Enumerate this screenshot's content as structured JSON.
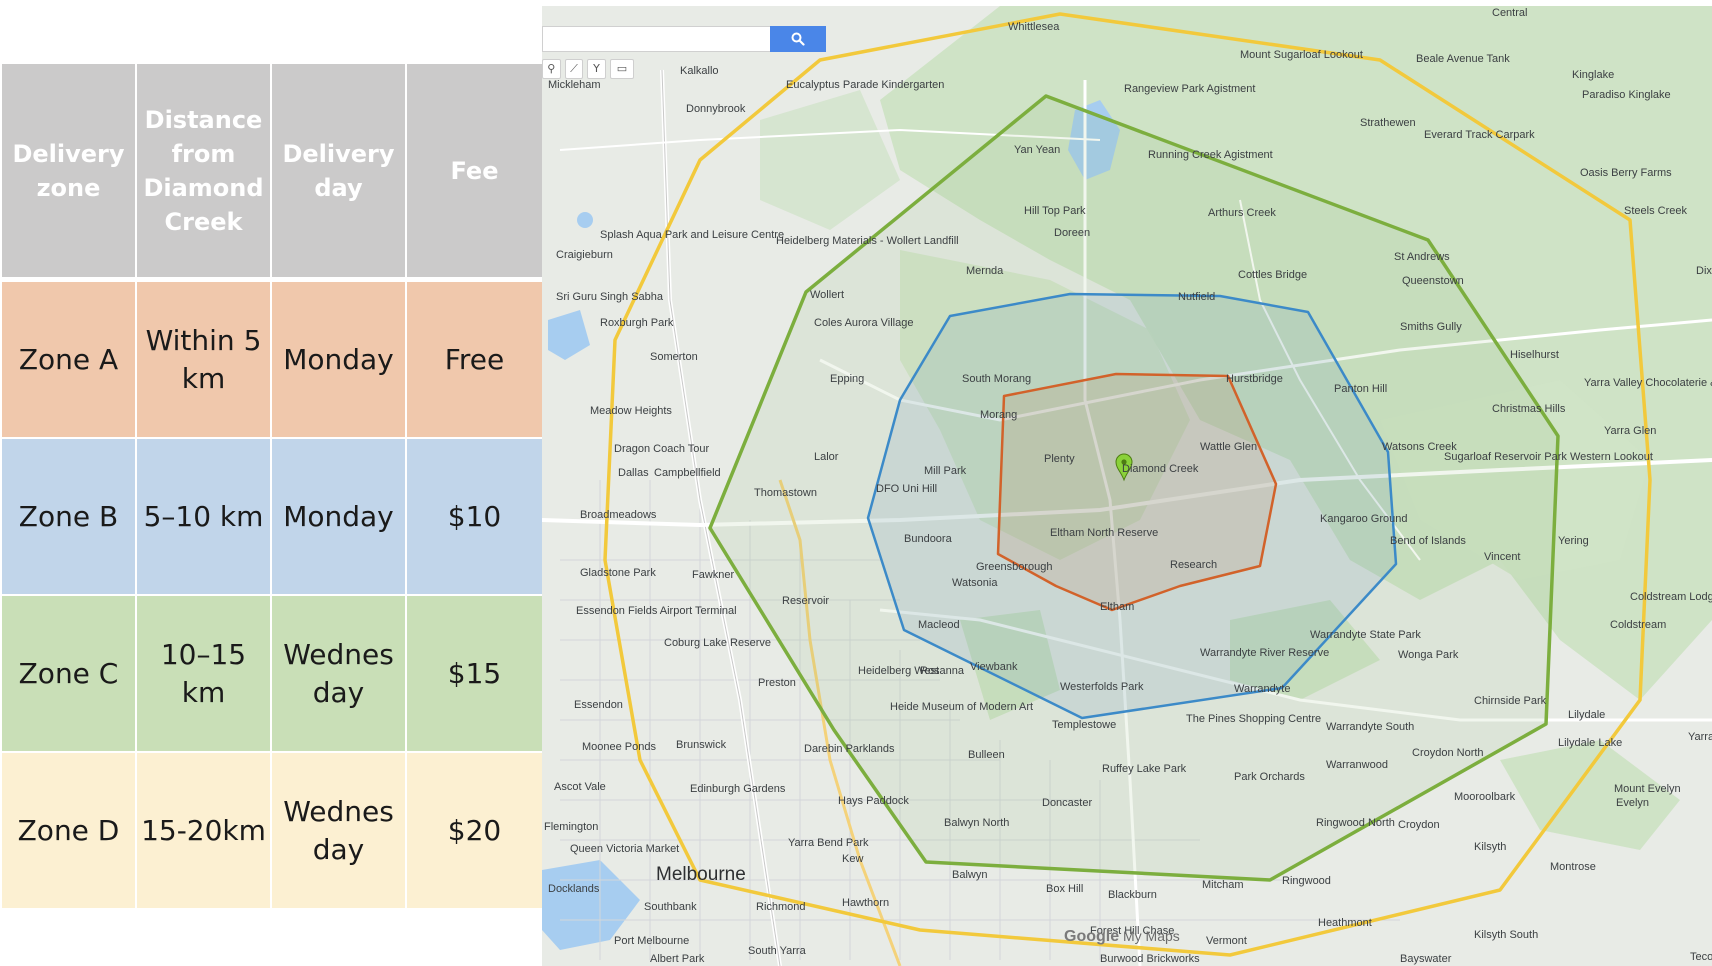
{
  "table": {
    "headers": [
      "Delivery zone",
      "Distance from Diamond Creek",
      "Delivery day",
      "Fee"
    ],
    "rows": [
      {
        "zone": "Zone A",
        "distance": "Within 5 km",
        "day": "Monday",
        "fee": "Free"
      },
      {
        "zone": "Zone B",
        "distance": "5–10 km",
        "day": "Monday",
        "fee": "$10"
      },
      {
        "zone": "Zone C",
        "distance": "10–15 km",
        "day": "Wednes day",
        "fee": "$15"
      },
      {
        "zone": "Zone D",
        "distance": "15-20km",
        "day": "Wednes day",
        "fee": "$20"
      }
    ],
    "colors": {
      "header": "#cbcaca",
      "zone_a": "#f0c8ac",
      "zone_b": "#c1d5ea",
      "zone_c": "#c9dfb7",
      "zone_d": "#fcf0d2"
    }
  },
  "map": {
    "watermark_logo": "Google",
    "watermark_text": "My Maps",
    "search_icon": "search-icon",
    "tools": [
      "marker-icon",
      "draw-line-icon",
      "directions-icon",
      "ruler-icon"
    ],
    "zone_colors": {
      "zone_a": "#d2622a",
      "zone_b": "#3c8ac8",
      "zone_c": "#7cae3e",
      "zone_d": "#f2c93c"
    },
    "center_marker": "Diamond Creek",
    "places": [
      "Whittlesea",
      "Kalkallo",
      "Mickleham",
      "Donnybrook",
      "Eucalyptus Parade Kindergarten",
      "Yan Yean",
      "Rangeview Park Agistment",
      "Mount Sugarloaf Lookout",
      "Beale Avenue Tank",
      "Kinglake",
      "Paradiso Kinglake",
      "Strathewen",
      "Everard Track Carpark",
      "Oasis Berry Farms",
      "Steels Creek",
      "Running Creek Agistment",
      "Hill Top Park",
      "Doreen",
      "Arthurs Creek",
      "Heidelberg Materials - Wollert Landfill",
      "Splash Aqua Park and Leisure Centre",
      "Craigieburn",
      "Mernda",
      "Cottles Bridge",
      "St Andrews",
      "Sri Guru Singh Sabha",
      "Wollert",
      "Nutfield",
      "Roxburgh Park",
      "Coles Aurora Village",
      "Smiths Gully",
      "Somerton",
      "Epping",
      "South Morang",
      "Hurstbridge",
      "Panton Hill",
      "Meadow Heights",
      "Christmas Hills",
      "Yarra Valley Chocolaterie & Ice Creamery",
      "Yarra Glen",
      "Dragon Coach Tour",
      "Lalor",
      "Plenty",
      "Wattle Glen",
      "Watsons Creek",
      "Dallas",
      "Campbellfield",
      "Mill Park",
      "Diamond Creek",
      "Sugarloaf Reservoir Park Western Lookout",
      "DFO Uni Hill",
      "Thomastown",
      "Broadmeadows",
      "Kangaroo Ground",
      "Eltham North Reserve",
      "Bend of Islands",
      "Yering",
      "Bundoora",
      "Greensborough",
      "Research",
      "Gladstone Park",
      "Fawkner",
      "Watsonia",
      "Essendon Fields Airport Terminal",
      "Reservoir",
      "Eltham",
      "Macleod",
      "Warrandyte State Park",
      "Wonga Park",
      "Coldstream",
      "Coburg Lake Reserve",
      "Warrandyte River Reserve",
      "Heidelberg West",
      "Rosanna",
      "Viewbank",
      "Warrandyte",
      "Preston",
      "Westerfolds Park",
      "Chirnside Park",
      "Essendon",
      "Heide Museum of Modern Art",
      "The Pines Shopping Centre",
      "Templestowe",
      "Lilydale",
      "Warrandyte South",
      "Moonee Ponds",
      "Brunswick",
      "Darebin Parklands",
      "Bulleen",
      "Ruffey Lake Park",
      "Croydon North",
      "Warranwood",
      "Edinburgh Gardens",
      "Hays Paddock",
      "Doncaster",
      "Park Orchards",
      "Mooroolbark",
      "Mount Evelyn",
      "Yarra Bend Park",
      "Balwyn North",
      "Ringwood North",
      "Croydon",
      "Queen Victoria Market",
      "Melbourne",
      "Kew",
      "Balwyn",
      "Box Hill",
      "Blackburn",
      "Mitcham",
      "Ringwood",
      "Kilsyth",
      "Montrose",
      "Southbank",
      "Richmond",
      "Hawthorn",
      "Heathmont",
      "Kilsyth South",
      "Port Melbourne",
      "South Yarra",
      "Vermont",
      "Bayswater",
      "Albert Park",
      "Burwood Brickworks",
      "Forest Hill Chase",
      "Central",
      "Dixons Creek",
      "Lilydale Lake",
      "Ascot Vale",
      "Flemington",
      "Docklands",
      "Tecoma",
      "Coldstream Lodge",
      "Yarra Park",
      "Queenstown",
      "Hiselhurst",
      "Morang",
      "Evelyn",
      "Vincent"
    ]
  }
}
